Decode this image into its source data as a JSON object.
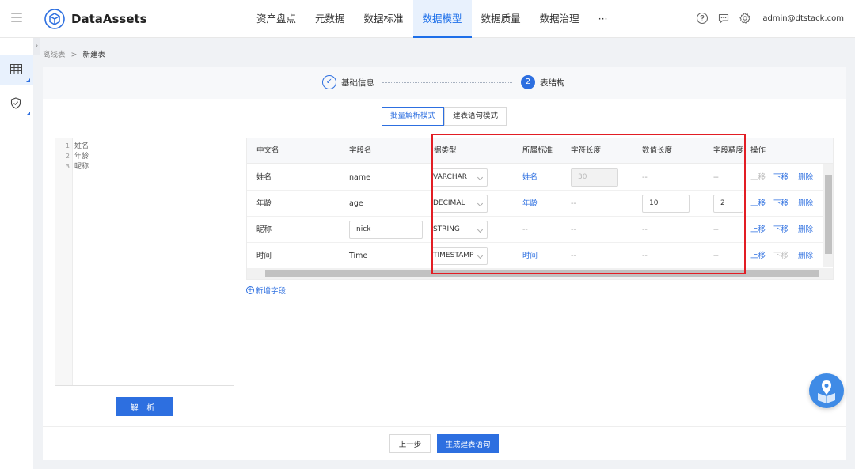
{
  "app": {
    "brand": "DataAssets",
    "user": "admin@dtstack.com"
  },
  "nav": [
    {
      "label": "资产盘点"
    },
    {
      "label": "元数据"
    },
    {
      "label": "数据标准"
    },
    {
      "label": "数据模型"
    },
    {
      "label": "数据质量"
    },
    {
      "label": "数据治理"
    },
    {
      "label": "···"
    }
  ],
  "nav_active": "数据模型",
  "icons": {
    "menu": "hamburger-icon",
    "logo": "cube-logo-icon",
    "help": "question-circle-icon",
    "message": "message-icon",
    "settings": "gear-icon",
    "table": "table-grid-icon",
    "shield": "shield-icon",
    "collapse": "chevron-right-icon",
    "fab": "map-pin-book-icon"
  },
  "breadcrumb": {
    "parent": "离线表",
    "separator": ">",
    "current": "新建表"
  },
  "steps": [
    {
      "index": "✓",
      "label": "基础信息",
      "status": "done"
    },
    {
      "index": "2",
      "label": "表结构",
      "status": "current"
    }
  ],
  "mode_tabs": [
    {
      "label": "批量解析模式",
      "active": true
    },
    {
      "label": "建表语句模式",
      "active": false
    }
  ],
  "editor_lines": [
    {
      "num": "1",
      "text": "姓名"
    },
    {
      "num": "2",
      "text": "年龄"
    },
    {
      "num": "3",
      "text": "昵称"
    }
  ],
  "parse_button": "解 析",
  "table": {
    "headers": [
      "中文名",
      "字段名",
      "据类型",
      "所属标准",
      "字符长度",
      "数值长度",
      "字段精度",
      "操作"
    ],
    "rows": [
      {
        "cn": "姓名",
        "field": "name",
        "type": "VARCHAR",
        "standard": "姓名",
        "char_len": "30",
        "num_len": "--",
        "precision": "--",
        "up": "上移",
        "down": "下移",
        "del": "删除"
      },
      {
        "cn": "年龄",
        "field": "age",
        "type": "DECIMAL",
        "standard": "年龄",
        "char_len": "--",
        "num_len": "10",
        "precision": "2",
        "up": "上移",
        "down": "下移",
        "del": "删除"
      },
      {
        "cn": "昵称",
        "field": "nick",
        "type": "STRING",
        "standard": "--",
        "char_len": "--",
        "num_len": "--",
        "precision": "--",
        "up": "上移",
        "down": "下移",
        "del": "删除"
      },
      {
        "cn": "时间",
        "field": "Time",
        "type": "TIMESTAMP",
        "standard": "时间",
        "char_len": "--",
        "num_len": "--",
        "precision": "--",
        "up": "上移",
        "down": "下移",
        "del": "删除"
      }
    ]
  },
  "add_field": "新增字段",
  "footer": {
    "prev": "上一步",
    "generate": "生成建表语句"
  },
  "colors": {
    "accent": "#2d6fe0",
    "highlight_border": "#e21d24",
    "nav_active_bg": "#e8f1fd"
  }
}
